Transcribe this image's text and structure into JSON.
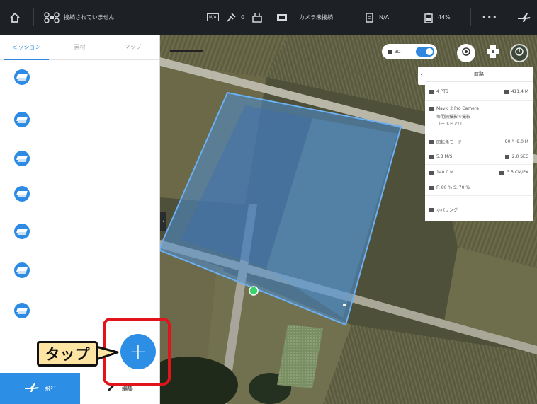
{
  "topbar": {
    "status_text": "接続されていません",
    "mode_label": "N/A",
    "signal_count": "0",
    "camera_label": "カメラ未接続",
    "gps_label": "N/A",
    "battery_label": "44%",
    "more_label": "•••"
  },
  "left_panel": {
    "tabs": [
      "ミッション",
      "素材",
      "マップ"
    ],
    "active_tab": 0,
    "mission_count": 7,
    "fly_button_label": "飛行",
    "edit_button_label": "編集"
  },
  "map": {
    "toggle_label": "3D",
    "collapse_label": "›",
    "handle_label": "‹"
  },
  "info_panel": {
    "title": "航路",
    "points": "4 PTS",
    "distance": "411.4 M",
    "camera": "Mavic 2 Pro Camera",
    "camera_mode_1": "等間隔撮影で撮影",
    "camera_mode_2": "コールドアロ",
    "gimbal_mode": "回転角モード",
    "gimbal_angle": "-90 °",
    "gimbal_height": "9.0 M",
    "speed": "5.8 M/S",
    "interval": "2.0 SEC",
    "altitude": "140.0 M",
    "gsd": "3.5 CM/PX",
    "overlap": "F: 80 %  S: 70 %",
    "action_label": "ホバリング"
  },
  "callout": {
    "text": "タップ"
  },
  "add_button": {
    "label": "+"
  },
  "colors": {
    "accent": "#2c8ee4",
    "highlight": "#e1141b",
    "callout_bg": "#fde4a2",
    "topbar": "#1d2024"
  },
  "icons": [
    "home-icon",
    "drone-icon",
    "flight-mode-icon",
    "remote-icon",
    "video-icon",
    "battery-icon",
    "gps-icon",
    "more-icon",
    "aircraft-icon",
    "compass-icon",
    "locate-icon",
    "layers-icon"
  ]
}
